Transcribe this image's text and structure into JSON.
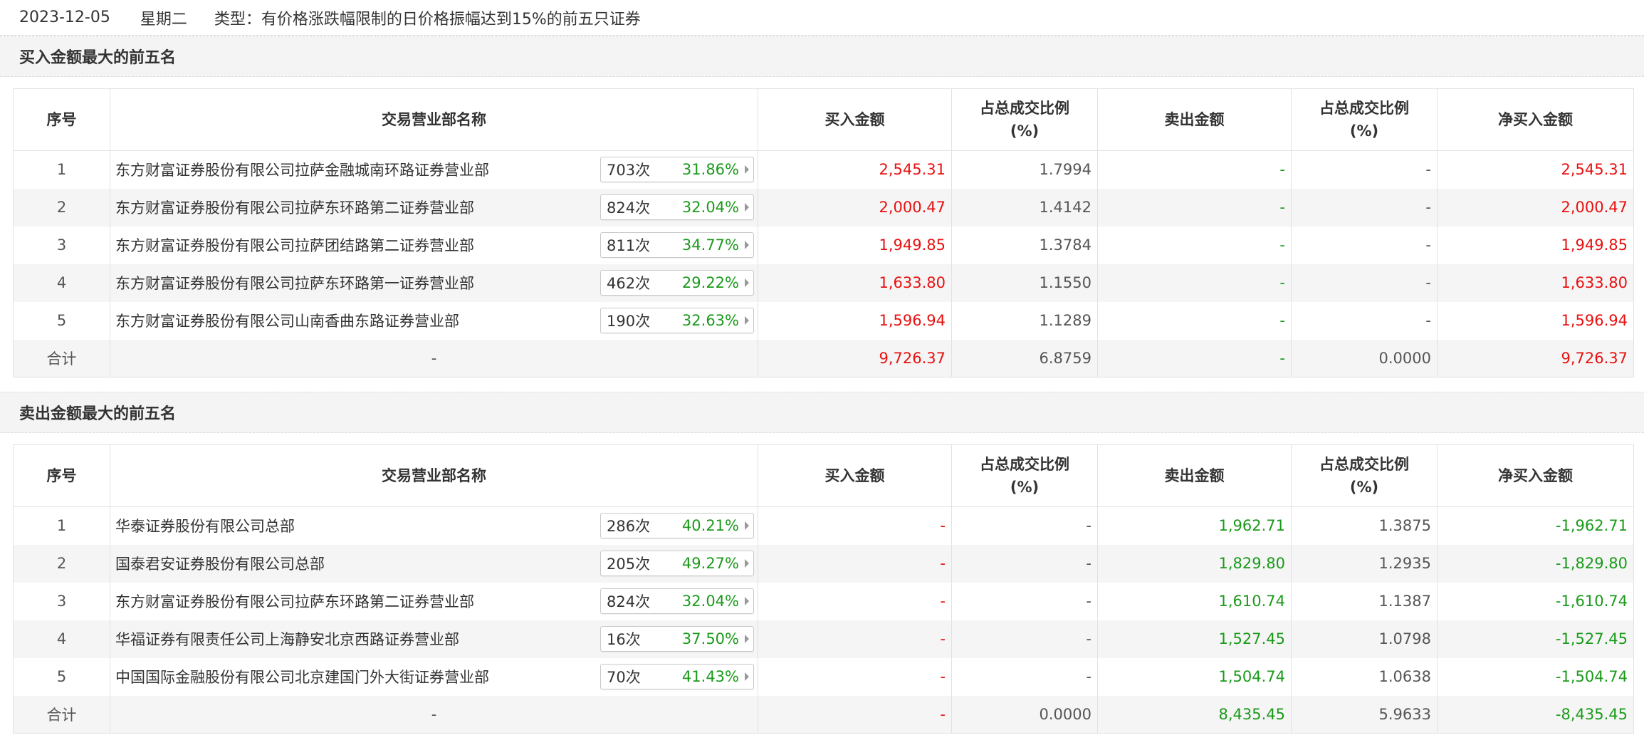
{
  "header": {
    "date": "2023-12-05",
    "weekday": "星期二",
    "type_label": "类型：有价格涨跌幅限制的日价格振幅达到15%的前五只证券"
  },
  "colors": {
    "up": "#e81010",
    "down": "#1a9a1a",
    "row_alt": "#f5f5f5"
  },
  "columns": {
    "idx": "序号",
    "name": "交易营业部名称",
    "buy": "买入金额",
    "buy_ratio_1": "占总成交比例",
    "buy_ratio_2": "(%)",
    "sell": "卖出金额",
    "sell_ratio_1": "占总成交比例",
    "sell_ratio_2": "(%)",
    "net": "净买入金额"
  },
  "buy_section": {
    "title": "买入金额最大的前五名",
    "rows": [
      {
        "idx": "1",
        "name": "东方财富证券股份有限公司拉萨金融城南环路证券营业部",
        "count": "703次",
        "pct": "31.86%",
        "buy": "2,545.31",
        "buy_ratio": "1.7994",
        "sell": "-",
        "sell_ratio": "-",
        "net": "2,545.31"
      },
      {
        "idx": "2",
        "name": "东方财富证券股份有限公司拉萨东环路第二证券营业部",
        "count": "824次",
        "pct": "32.04%",
        "buy": "2,000.47",
        "buy_ratio": "1.4142",
        "sell": "-",
        "sell_ratio": "-",
        "net": "2,000.47"
      },
      {
        "idx": "3",
        "name": "东方财富证券股份有限公司拉萨团结路第二证券营业部",
        "count": "811次",
        "pct": "34.77%",
        "buy": "1,949.85",
        "buy_ratio": "1.3784",
        "sell": "-",
        "sell_ratio": "-",
        "net": "1,949.85"
      },
      {
        "idx": "4",
        "name": "东方财富证券股份有限公司拉萨东环路第一证券营业部",
        "count": "462次",
        "pct": "29.22%",
        "buy": "1,633.80",
        "buy_ratio": "1.1550",
        "sell": "-",
        "sell_ratio": "-",
        "net": "1,633.80"
      },
      {
        "idx": "5",
        "name": "东方财富证券股份有限公司山南香曲东路证券营业部",
        "count": "190次",
        "pct": "32.63%",
        "buy": "1,596.94",
        "buy_ratio": "1.1289",
        "sell": "-",
        "sell_ratio": "-",
        "net": "1,596.94"
      }
    ],
    "total": {
      "label": "合计",
      "name": "-",
      "buy": "9,726.37",
      "buy_ratio": "6.8759",
      "sell": "-",
      "sell_ratio": "0.0000",
      "net": "9,726.37"
    }
  },
  "sell_section": {
    "title": "卖出金额最大的前五名",
    "rows": [
      {
        "idx": "1",
        "name": "华泰证券股份有限公司总部",
        "count": "286次",
        "pct": "40.21%",
        "buy": "-",
        "buy_ratio": "-",
        "sell": "1,962.71",
        "sell_ratio": "1.3875",
        "net": "-1,962.71"
      },
      {
        "idx": "2",
        "name": "国泰君安证券股份有限公司总部",
        "count": "205次",
        "pct": "49.27%",
        "buy": "-",
        "buy_ratio": "-",
        "sell": "1,829.80",
        "sell_ratio": "1.2935",
        "net": "-1,829.80"
      },
      {
        "idx": "3",
        "name": "东方财富证券股份有限公司拉萨东环路第二证券营业部",
        "count": "824次",
        "pct": "32.04%",
        "buy": "-",
        "buy_ratio": "-",
        "sell": "1,610.74",
        "sell_ratio": "1.1387",
        "net": "-1,610.74"
      },
      {
        "idx": "4",
        "name": "华福证券有限责任公司上海静安北京西路证券营业部",
        "count": "16次",
        "pct": "37.50%",
        "buy": "-",
        "buy_ratio": "-",
        "sell": "1,527.45",
        "sell_ratio": "1.0798",
        "net": "-1,527.45"
      },
      {
        "idx": "5",
        "name": "中国国际金融股份有限公司北京建国门外大街证券营业部",
        "count": "70次",
        "pct": "41.43%",
        "buy": "-",
        "buy_ratio": "-",
        "sell": "1,504.74",
        "sell_ratio": "1.0638",
        "net": "-1,504.74"
      }
    ],
    "total": {
      "label": "合计",
      "name": "-",
      "buy": "-",
      "buy_ratio": "0.0000",
      "sell": "8,435.45",
      "sell_ratio": "5.9633",
      "net": "-8,435.45"
    }
  }
}
